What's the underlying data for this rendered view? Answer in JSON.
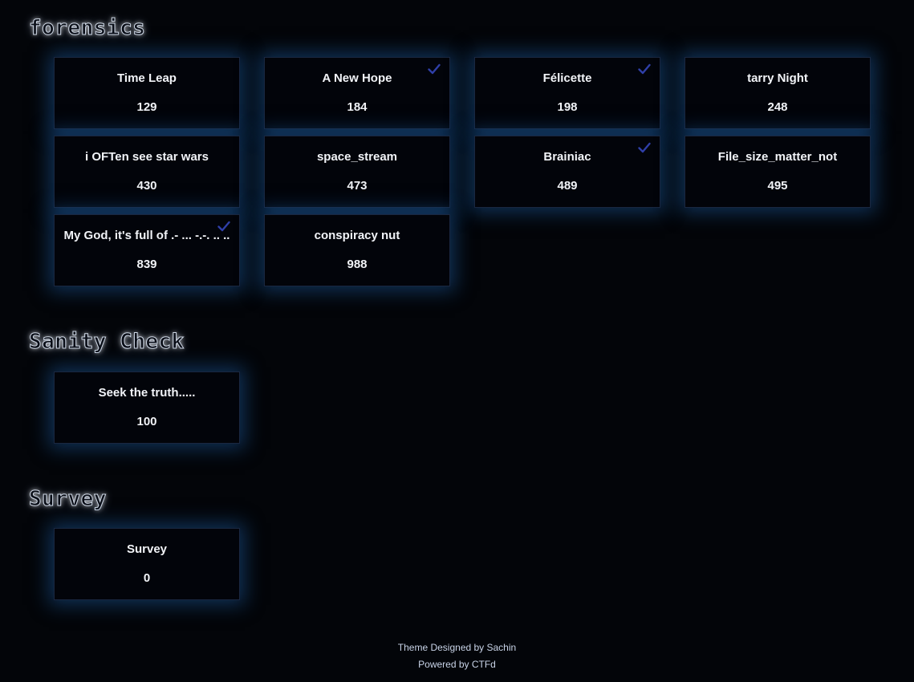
{
  "categories": [
    {
      "title": "forensics",
      "challenges": [
        {
          "name": "Time Leap",
          "points": "129",
          "solved": false
        },
        {
          "name": "A New Hope",
          "points": "184",
          "solved": true
        },
        {
          "name": "Félicette",
          "points": "198",
          "solved": true
        },
        {
          "name": "tarry Night",
          "points": "248",
          "solved": false
        },
        {
          "name": "i OFTen see star wars",
          "points": "430",
          "solved": false
        },
        {
          "name": "space_stream",
          "points": "473",
          "solved": false
        },
        {
          "name": "Brainiac",
          "points": "489",
          "solved": true
        },
        {
          "name": "File_size_matter_not",
          "points": "495",
          "solved": false
        },
        {
          "name": "My God, it's full of .- ... -.-. .. ..",
          "points": "839",
          "solved": true
        },
        {
          "name": "conspiracy nut",
          "points": "988",
          "solved": false
        }
      ]
    },
    {
      "title": "Sanity Check",
      "challenges": [
        {
          "name": "Seek the truth.....",
          "points": "100",
          "solved": false
        }
      ]
    },
    {
      "title": "Survey",
      "challenges": [
        {
          "name": "Survey",
          "points": "0",
          "solved": false
        }
      ]
    }
  ],
  "footer": {
    "theme_credit": "Theme Designed by Sachin",
    "powered_by": "Powered by CTFd"
  },
  "colors": {
    "background": "#030509",
    "card_glow": "#1955a0",
    "solved_check": "#2f3fa8"
  },
  "icons": {
    "solved": "check-icon"
  }
}
